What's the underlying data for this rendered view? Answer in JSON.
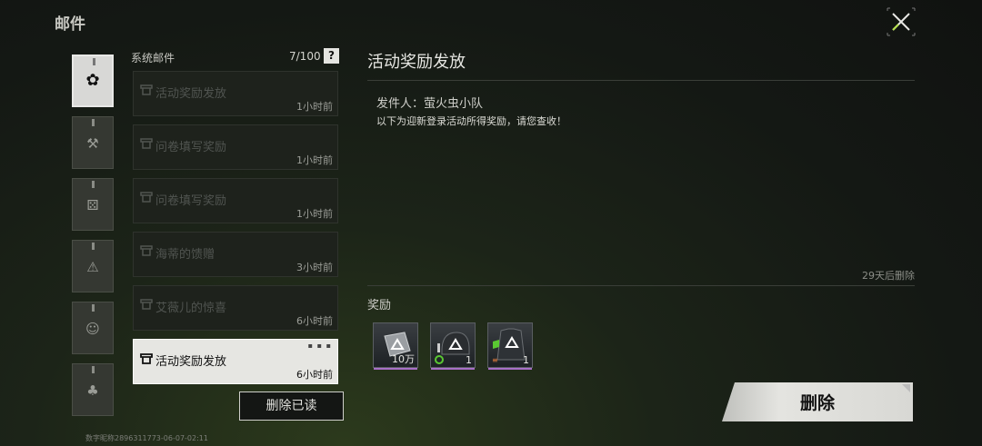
{
  "window": {
    "title": "邮件"
  },
  "mail_list": {
    "header": "系统邮件",
    "count": "7/100",
    "help_label": "?",
    "items": [
      {
        "subject": "活动奖励发放",
        "time": "1小时前"
      },
      {
        "subject": "问卷填写奖励",
        "time": "1小时前"
      },
      {
        "subject": "问卷填写奖励",
        "time": "1小时前"
      },
      {
        "subject": "海蒂的馈赠",
        "time": "3小时前"
      },
      {
        "subject": "艾薇儿的惊喜",
        "time": "6小时前"
      },
      {
        "subject": "活动奖励发放",
        "time": "6小时前"
      }
    ],
    "delete_read_label": "删除已读"
  },
  "detail": {
    "title": "活动奖励发放",
    "sender": "发件人：萤火虫小队",
    "body": "以下为迎新登录活动所得奖励，请您查收！",
    "expire": "29天后删除",
    "rewards_label": "奖励",
    "rewards": [
      {
        "icon": "currency-icon",
        "qty": "10万"
      },
      {
        "icon": "helmet-icon",
        "qty": "1"
      },
      {
        "icon": "armor-vest-icon",
        "qty": "1"
      }
    ],
    "delete_label": "删除"
  },
  "footer": {
    "id_text": "数字昵称2896311773-06-07-02:11"
  },
  "colors": {
    "background": "#141814",
    "selected_item": "#e6e6e2",
    "reward_rarity": "#a86fc8",
    "accent_green": "#5ac832"
  }
}
